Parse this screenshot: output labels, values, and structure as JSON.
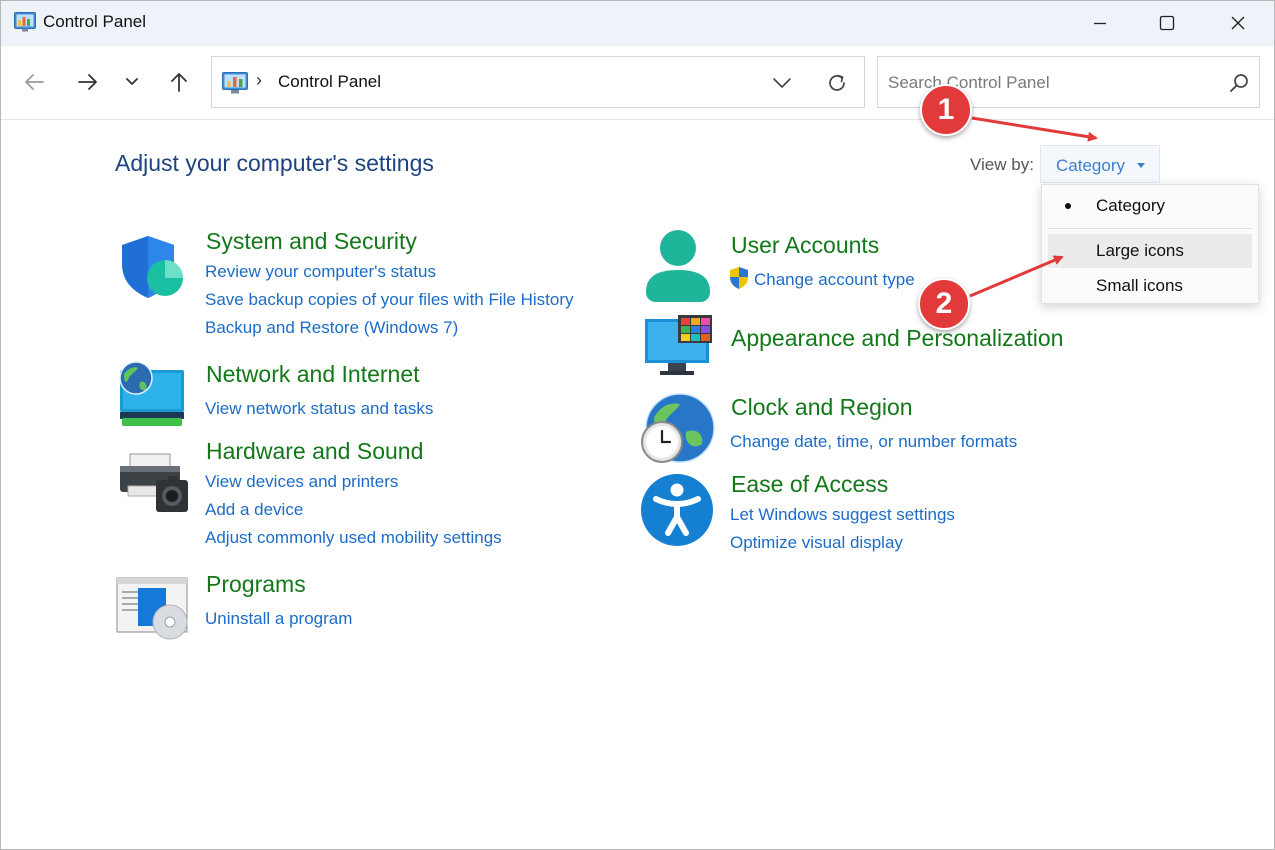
{
  "window": {
    "title": "Control Panel"
  },
  "toolbar": {
    "address_path": "Control Panel",
    "address_separator": "›",
    "search_placeholder": "Search Control Panel"
  },
  "main": {
    "heading": "Adjust your computer's settings",
    "view_by_label": "View by:",
    "view_by_value": "Category",
    "view_by_options": [
      "Category",
      "Large icons",
      "Small icons"
    ],
    "selected_option": "Category",
    "hovered_option": "Large icons"
  },
  "categories": {
    "system_security": {
      "title": "System and Security",
      "links": [
        "Review your computer's status",
        "Save backup copies of your files with File History",
        "Backup and Restore (Windows 7)"
      ]
    },
    "network": {
      "title": "Network and Internet",
      "links": [
        "View network status and tasks"
      ]
    },
    "hardware": {
      "title": "Hardware and Sound",
      "links": [
        "View devices and printers",
        "Add a device",
        "Adjust commonly used mobility settings"
      ]
    },
    "programs": {
      "title": "Programs",
      "links": [
        "Uninstall a program"
      ]
    },
    "user_accounts": {
      "title": "User Accounts",
      "links": [
        "Change account type"
      ]
    },
    "appearance": {
      "title": "Appearance and Personalization",
      "links": []
    },
    "clock": {
      "title": "Clock and Region",
      "links": [
        "Change date, time, or number formats"
      ]
    },
    "ease": {
      "title": "Ease of Access",
      "links": [
        "Let Windows suggest settings",
        "Optimize visual display"
      ]
    }
  },
  "annotations": {
    "marker1": "1",
    "marker2": "2"
  },
  "colors": {
    "category_title": "#137819",
    "link": "#1c6cc7",
    "heading": "#1d4380",
    "annotation": "#e23a3a"
  }
}
